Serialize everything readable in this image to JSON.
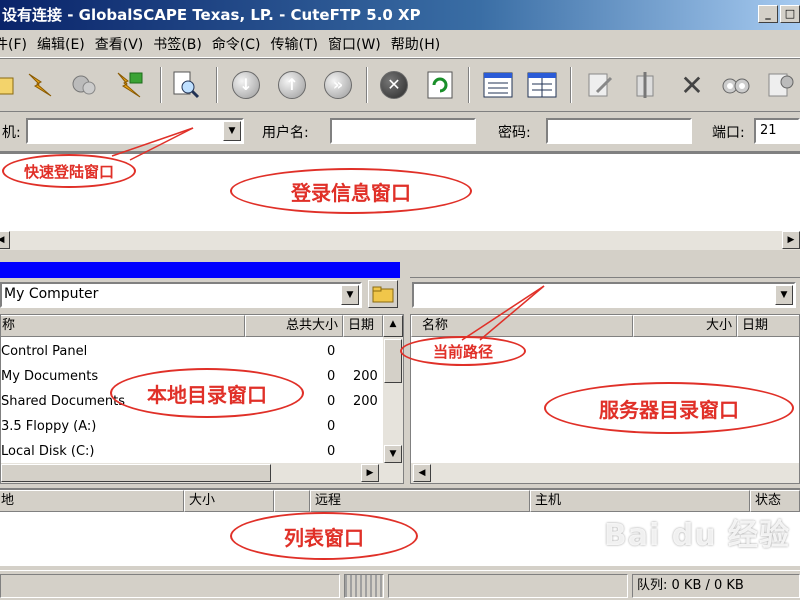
{
  "window": {
    "title": "设有连接 - GlobalSCAPE Texas, LP. - CuteFTP 5.0 XP",
    "minimize_icon": "minimize-icon",
    "maximize_icon": "maximize-icon"
  },
  "menu": [
    "件(F)",
    "编辑(E)",
    "查看(V)",
    "书签(B)",
    "命令(C)",
    "传输(T)",
    "窗口(W)",
    "帮助(H)"
  ],
  "quick_connect": {
    "host_label": "机:",
    "host_value": "",
    "user_label": "用户名:",
    "user_value": "",
    "password_label": "密码:",
    "password_value": "",
    "port_label": "端口:",
    "port_value": "21"
  },
  "local": {
    "path": "My Computer",
    "columns": [
      "称",
      "总共大小",
      "日期"
    ],
    "rows": [
      {
        "name": "Control Panel",
        "size": "0",
        "date": ""
      },
      {
        "name": "My Documents",
        "size": "0",
        "date": "200"
      },
      {
        "name": "Shared Documents",
        "size": "0",
        "date": "200"
      },
      {
        "name": "3.5 Floppy (A:)",
        "size": "0",
        "date": ""
      },
      {
        "name": "Local Disk (C:)",
        "size": "0",
        "date": ""
      }
    ]
  },
  "remote": {
    "path": "",
    "columns": [
      "名称",
      "大小",
      "日期"
    ]
  },
  "queue": {
    "columns": [
      "地",
      "大小",
      "远程",
      "主机",
      "状态"
    ]
  },
  "status": {
    "queue_text": "队列: 0 KB / 0 KB"
  },
  "annotations": {
    "quick_login": "快速登陆窗口",
    "login_info": "登录信息窗口",
    "current_path": "当前路径",
    "local_dir": "本地目录窗口",
    "server_dir": "服务器目录窗口",
    "list_window": "列表窗口"
  },
  "watermark": "Bai du 经验",
  "colors": {
    "title_bar": "#0a246a",
    "active_pane": "#0000ff",
    "annotation": "#e03028",
    "face": "#d4d0c8"
  }
}
